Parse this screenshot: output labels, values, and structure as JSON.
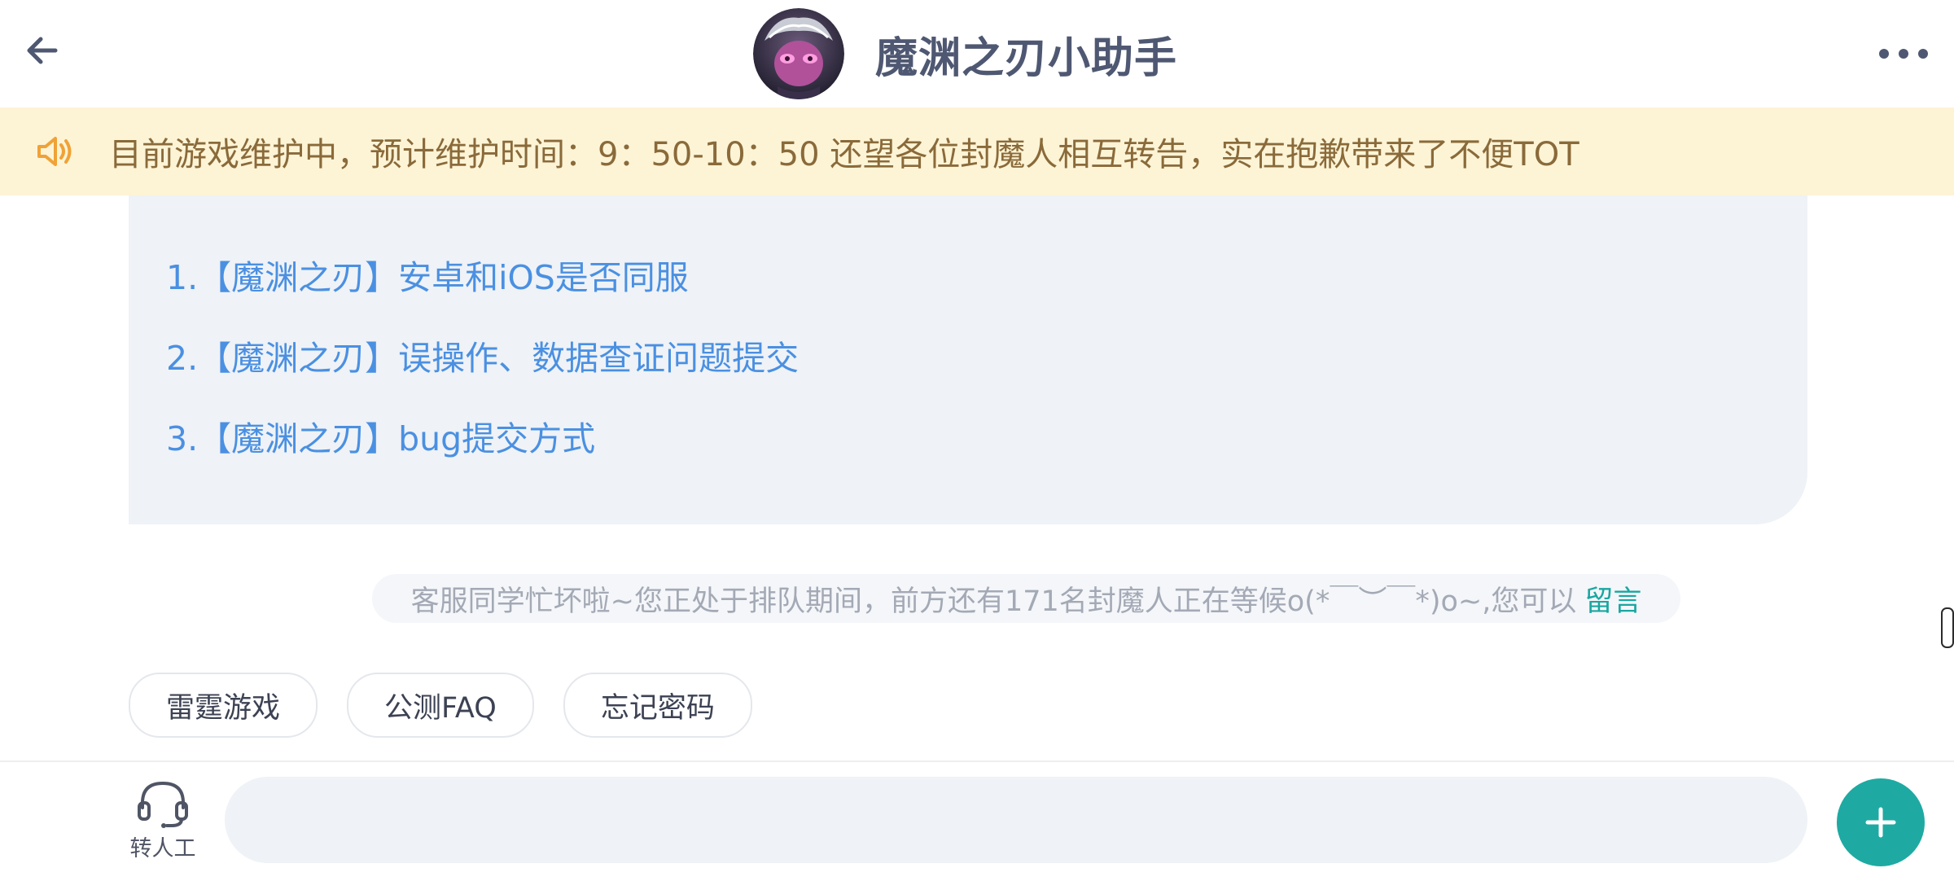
{
  "header": {
    "title": "魔渊之刃小助手",
    "back_icon": "arrow-left-icon",
    "more_icon": "more-horizontal-icon"
  },
  "notice": {
    "icon": "speaker-icon",
    "text": "目前游戏维护中，预计维护时间：9：50-10：50 还望各位封魔人相互转告，实在抱歉带来了不便TOT"
  },
  "bot_message": {
    "faq_links": [
      "1.【魔渊之刃】安卓和iOS是否同服",
      "2.【魔渊之刃】误操作、数据查证问题提交",
      "3.【魔渊之刃】bug提交方式"
    ]
  },
  "queue_notice": {
    "text": "客服同学忙坏啦~您正处于排队期间，前方还有171名封魔人正在等候o(*￣︶￣*)o~,您可以",
    "link": "留言"
  },
  "quick_replies": [
    "雷霆游戏",
    "公测FAQ",
    "忘记密码"
  ],
  "bottom_bar": {
    "human_label": "转人工",
    "human_icon": "headset-icon",
    "input_value": "",
    "plus_icon": "plus-icon"
  },
  "colors": {
    "accent": "#1eaaa2",
    "link": "#4a90e2",
    "notice_bg": "#fdf4d6",
    "notice_text": "#8a6a3a",
    "notice_icon": "#f0a236"
  }
}
